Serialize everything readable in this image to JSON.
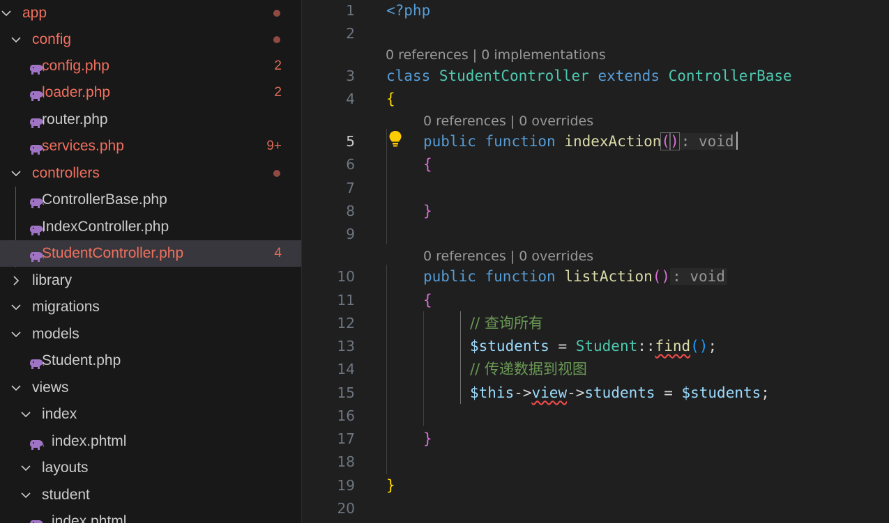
{
  "explorer": {
    "rows": [
      {
        "label": "app",
        "badge": "",
        "dot": true,
        "type": "folder",
        "expanded": true,
        "level": 0,
        "modified": true,
        "selected": false
      },
      {
        "label": "config",
        "badge": "",
        "dot": true,
        "type": "folder",
        "expanded": true,
        "level": 1,
        "modified": true,
        "selected": false
      },
      {
        "label": "config.php",
        "badge": "2",
        "dot": false,
        "type": "php",
        "level": 2,
        "modified": true,
        "selected": false
      },
      {
        "label": "loader.php",
        "badge": "2",
        "dot": false,
        "type": "php",
        "level": 2,
        "modified": true,
        "selected": false
      },
      {
        "label": "router.php",
        "badge": "",
        "dot": false,
        "type": "php",
        "level": 2,
        "modified": false,
        "selected": false
      },
      {
        "label": "services.php",
        "badge": "9+",
        "dot": false,
        "type": "php",
        "level": 2,
        "modified": true,
        "selected": false
      },
      {
        "label": "controllers",
        "badge": "",
        "dot": true,
        "type": "folder",
        "expanded": true,
        "level": 1,
        "modified": true,
        "selected": false
      },
      {
        "label": "ControllerBase.php",
        "badge": "",
        "dot": false,
        "type": "php",
        "level": 2,
        "modified": false,
        "selected": false
      },
      {
        "label": "IndexController.php",
        "badge": "",
        "dot": false,
        "type": "php",
        "level": 2,
        "modified": false,
        "selected": false
      },
      {
        "label": "StudentController.php",
        "badge": "4",
        "dot": false,
        "type": "php",
        "level": 2,
        "modified": true,
        "selected": true
      },
      {
        "label": "library",
        "badge": "",
        "dot": false,
        "type": "folder",
        "expanded": false,
        "level": 1,
        "modified": false,
        "selected": false
      },
      {
        "label": "migrations",
        "badge": "",
        "dot": false,
        "type": "folder",
        "expanded": true,
        "level": 1,
        "modified": false,
        "selected": false
      },
      {
        "label": "models",
        "badge": "",
        "dot": false,
        "type": "folder",
        "expanded": true,
        "level": 1,
        "modified": false,
        "selected": false
      },
      {
        "label": "Student.php",
        "badge": "",
        "dot": false,
        "type": "php",
        "level": 2,
        "modified": false,
        "selected": false
      },
      {
        "label": "views",
        "badge": "",
        "dot": false,
        "type": "folder",
        "expanded": true,
        "level": 1,
        "modified": false,
        "selected": false
      },
      {
        "label": "index",
        "badge": "",
        "dot": false,
        "type": "folder",
        "expanded": true,
        "level": 2,
        "modified": false,
        "selected": false
      },
      {
        "label": "index.phtml",
        "badge": "",
        "dot": false,
        "type": "php",
        "level": 3,
        "modified": false,
        "selected": false
      },
      {
        "label": "layouts",
        "badge": "",
        "dot": false,
        "type": "folder",
        "expanded": true,
        "level": 2,
        "modified": false,
        "selected": false
      },
      {
        "label": "student",
        "badge": "",
        "dot": false,
        "type": "folder",
        "expanded": true,
        "level": 2,
        "modified": false,
        "selected": false
      },
      {
        "label": "index.phtml",
        "badge": "",
        "dot": false,
        "type": "php",
        "level": 3,
        "modified": false,
        "selected": false
      }
    ]
  },
  "editor": {
    "active_line": 5,
    "codelens": {
      "class_lens": "0 references | 0 implementations",
      "index_lens": "0 references | 0 overrides",
      "list_lens": "0 references | 0 overrides"
    },
    "line_numbers": [
      "1",
      "2",
      "3",
      "4",
      "5",
      "6",
      "7",
      "8",
      "9",
      "10",
      "11",
      "12",
      "13",
      "14",
      "15",
      "16",
      "17",
      "18",
      "19",
      "20"
    ],
    "code": {
      "php_open": "<?php",
      "kw_class": "class",
      "class_name": "StudentController",
      "kw_extends": "extends",
      "base_class": "ControllerBase",
      "brace_open": "{",
      "brace_close": "}",
      "kw_public": "public",
      "kw_function": "function",
      "fn_index": "indexAction",
      "fn_list": "listAction",
      "paren_open": "(",
      "paren_close": ")",
      "return_hint": ": void",
      "comment_query": "// 查询所有",
      "var_students": "$students",
      "op_assign": " = ",
      "model_name": "Student",
      "op_static": "::",
      "fn_find": "find",
      "semicolon": ";",
      "comment_pass": "// 传递数据到视图",
      "var_this": "$this",
      "arrow": "->",
      "prop_view": "view",
      "prop_students": "students"
    }
  },
  "icons": {
    "php_file_icon": "elephant-icon",
    "chevron_expanded": "chevron-down-icon",
    "chevron_collapsed": "chevron-right-icon",
    "lightbulb": "lightbulb-icon"
  },
  "colors": {
    "modified_text": "#f0705f",
    "php_icon": "#a074c4",
    "selected_row": "#37373d"
  }
}
